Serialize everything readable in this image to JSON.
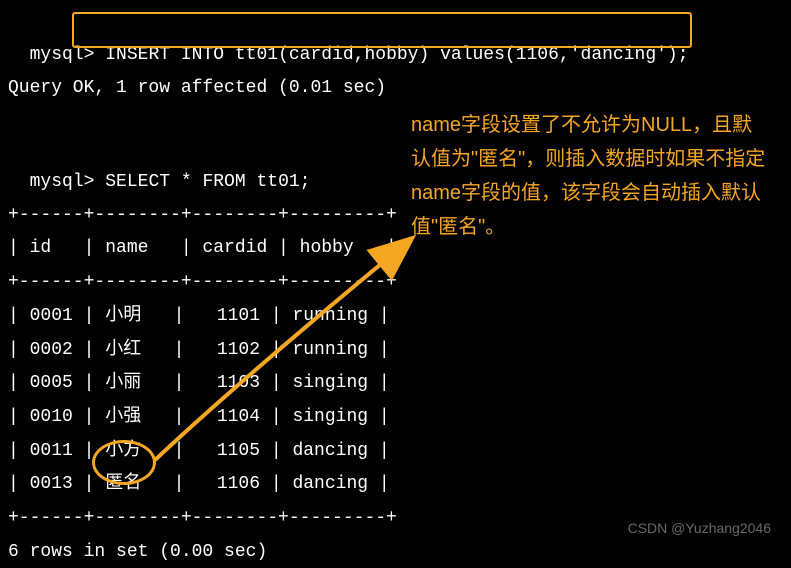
{
  "prompt": "mysql>",
  "insert_query": "INSERT INTO tt01(cardid,hobby) values(1106,'dancing');",
  "query_result": "Query OK, 1 row affected (0.01 sec)",
  "select_query": "SELECT * FROM tt01;",
  "table_border": "+------+--------+--------+---------+",
  "table_header": "| id   | name   | cardid | hobby   |",
  "rows": [
    "| 0001 | 小明   |   1101 | running |",
    "| 0002 | 小红   |   1102 | running |",
    "| 0005 | 小丽   |   1103 | singing |",
    "| 0010 | 小强   |   1104 | singing |",
    "| 0011 | 小方   |   1105 | dancing |",
    "| 0013 | 匿名   |   1106 | dancing |"
  ],
  "rows_summary": "6 rows in set (0.00 sec)",
  "annotation": "name字段设置了不允许为NULL，且默认值为\"匿名\"，则插入数据时如果不指定name字段的值，该字段会自动插入默认值\"匿名\"。",
  "watermark": "CSDN @Yuzhang2046",
  "chart_data": {
    "type": "table",
    "columns": [
      "id",
      "name",
      "cardid",
      "hobby"
    ],
    "data": [
      {
        "id": "0001",
        "name": "小明",
        "cardid": 1101,
        "hobby": "running"
      },
      {
        "id": "0002",
        "name": "小红",
        "cardid": 1102,
        "hobby": "running"
      },
      {
        "id": "0005",
        "name": "小丽",
        "cardid": 1103,
        "hobby": "singing"
      },
      {
        "id": "0010",
        "name": "小强",
        "cardid": 1104,
        "hobby": "singing"
      },
      {
        "id": "0011",
        "name": "小方",
        "cardid": 1105,
        "hobby": "dancing"
      },
      {
        "id": "0013",
        "name": "匿名",
        "cardid": 1106,
        "hobby": "dancing"
      }
    ]
  }
}
